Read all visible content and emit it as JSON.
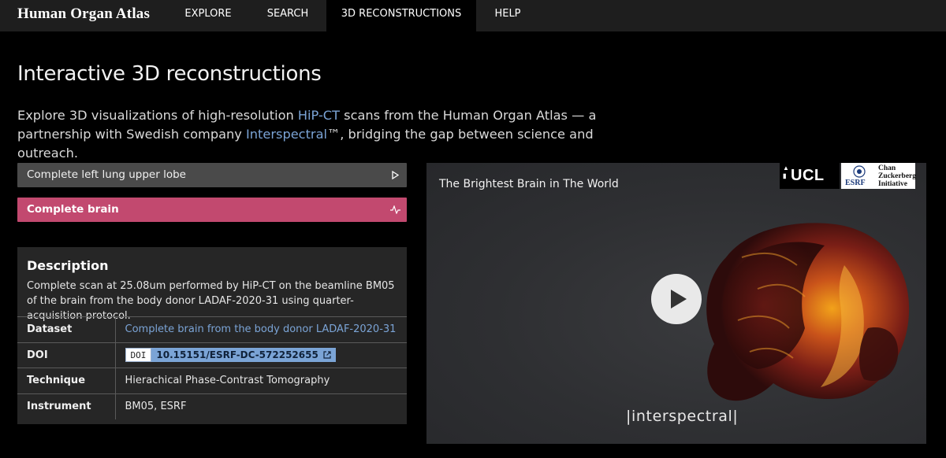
{
  "nav": {
    "brand": "Human Organ Atlas",
    "items": [
      {
        "label": "EXPLORE",
        "active": false
      },
      {
        "label": "SEARCH",
        "active": false
      },
      {
        "label": "3D RECONSTRUCTIONS",
        "active": true
      },
      {
        "label": "HELP",
        "active": false
      }
    ]
  },
  "page": {
    "title": "Interactive 3D reconstructions",
    "intro": {
      "part1": "Explore 3D visualizations of high-resolution ",
      "link1": "HiP-CT",
      "part2": " scans from the Human Organ Atlas — a partnership with Swedish company ",
      "link2": "Interspectral",
      "part3": "™, bridging the gap between science and outreach."
    }
  },
  "options": [
    {
      "label": "Complete left lung upper lobe",
      "icon": "play-triangle-icon",
      "selected": false
    },
    {
      "label": "Complete brain",
      "icon": "pulse-icon",
      "selected": true
    }
  ],
  "description": {
    "title": "Description",
    "text": "Complete scan at 25.08um performed by HiP-CT on the beamline BM05 of the brain from the body donor LADAF-2020-31 using quarter-acquisition protocol.",
    "rows": {
      "dataset": {
        "label": "Dataset",
        "value": "Complete brain from the body donor LADAF-2020-31"
      },
      "doi": {
        "label": "DOI",
        "badge_key": "DOI",
        "value": "10.15151/ESRF-DC-572252655"
      },
      "technique": {
        "label": "Technique",
        "value": "Hierachical Phase-Contrast Tomography"
      },
      "instrument": {
        "label": "Instrument",
        "value": "BM05, ESRF"
      }
    }
  },
  "video": {
    "title": "The Brightest Brain in The World",
    "logos": {
      "ucl": "UCL",
      "esrf": "ESRF",
      "czi": "Chan Zuckerberg Initiative"
    },
    "watermark": "|interspectral|"
  },
  "colors": {
    "accent_pink": "#c2496f",
    "link_blue": "#7ba4d6",
    "nav_bg": "#1e1e1e"
  }
}
